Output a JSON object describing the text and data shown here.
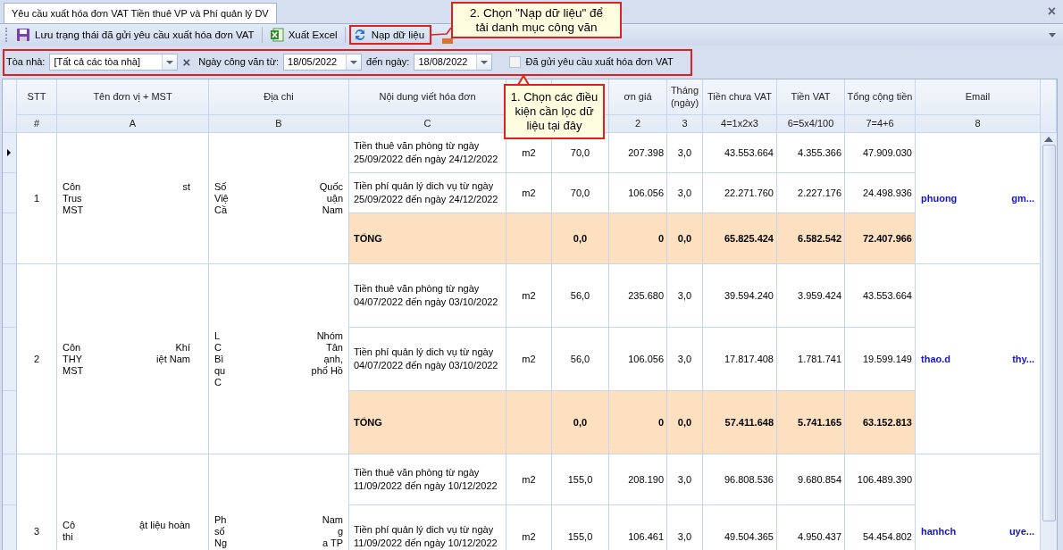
{
  "tab": {
    "title": "Yêu cầu xuất hóa đơn VAT Tiền thuê VP và Phí quản lý DV",
    "selected": true,
    "close": "×"
  },
  "toolbar": [
    {
      "kind": "save",
      "label": "Lưu trạng thái đã gửi yêu cầu xuất hóa đơn VAT"
    },
    {
      "kind": "excel",
      "label": "Xuất Excel"
    },
    {
      "kind": "refresh",
      "label": "Nạp dữ liệu"
    }
  ],
  "filters": {
    "building_label": "Tòa nhà:",
    "building": "[Tất cả các tòa nhà]",
    "clear": "×",
    "from_label": "Ngày công văn từ:",
    "from": "18/05/2022",
    "to_label": "đến ngày:",
    "to": "18/08/2022",
    "sent_label": "Đã gửi yêu cầu xuất hóa đơn VAT",
    "sent_checked": false
  },
  "callouts": [
    {
      "text": "2. Chọn \"Nạp dữ liệu\" để tải danh mục công văn"
    },
    {
      "text": "1. Chọn các điều kiện cần lọc dữ liệu tại đây"
    }
  ],
  "columns": [
    {
      "title": "STT",
      "formula": "#"
    },
    {
      "title": "Tên đơn vị + MST",
      "formula": "A"
    },
    {
      "title": "Địa chi",
      "formula": "B"
    },
    {
      "title": "Nội dung viết hóa đơn",
      "formula": "C"
    },
    {
      "title": "ơn giá",
      "formula": "2"
    },
    {
      "title": "Tháng (ngày)",
      "formula": "3"
    },
    {
      "title": "Tiền chưa VAT",
      "formula": "4=1x2x3"
    },
    {
      "title": "Tiền VAT",
      "formula": "6=5x4/100"
    },
    {
      "title": "Tổng cộng tiền",
      "formula": "7=4+6"
    },
    {
      "title": "Email",
      "formula": "8"
    }
  ],
  "groups": [
    {
      "stt": "1",
      "name": [
        {
          "l": "Côn",
          "r": "st"
        },
        {
          "l": "Trus"
        },
        {
          "l": "MST"
        }
      ],
      "address": [
        {
          "l": "Số",
          "r": "Quốc"
        },
        {
          "l": "Việ",
          "r": "uận"
        },
        {
          "l": "Cầ",
          "r": "Nam"
        }
      ],
      "email": {
        "l": "phuong",
        "r": "gm..."
      },
      "lines": [
        {
          "kind": "item",
          "selected": true,
          "content": "Tiền thuê văn phòng từ ngày 25/09/2022 đến ngày 24/12/2022",
          "unit": "m2",
          "qty": "70,0",
          "price": "207.398",
          "months": "3,0",
          "pre": "43.553.664",
          "vat": "4.355.366",
          "total": "47.909.030"
        },
        {
          "kind": "item",
          "selected": false,
          "content": "Tiền phí quản lý dich vụ từ ngày 25/09/2022 đến ngày 24/12/2022",
          "unit": "m2",
          "qty": "70,0",
          "price": "106.056",
          "months": "3,0",
          "pre": "22.271.760",
          "vat": "2.227.176",
          "total": "24.498.936"
        },
        {
          "kind": "total",
          "selected": false,
          "content": "TỔNG",
          "qty": "0,0",
          "price": "0",
          "months": "0,0",
          "pre": "65.825.424",
          "vat": "6.582.542",
          "total": "72.407.966"
        }
      ]
    },
    {
      "stt": "2",
      "name": [
        {
          "l": "Côn",
          "r": "Khí"
        },
        {
          "l": "THY",
          "r": "iệt Nam"
        },
        {
          "l": "MST"
        }
      ],
      "address": [
        {
          "l": "L",
          "r": "Nhóm"
        },
        {
          "l": "C",
          "r": "Tân"
        },
        {
          "l": "Bì",
          "r": "ạnh,"
        },
        {
          "l": "qu",
          "r": "phố Hồ"
        },
        {
          "l": "C"
        }
      ],
      "email": {
        "l": "thao.d",
        "r": "thy..."
      },
      "lines": [
        {
          "kind": "item",
          "selected": false,
          "content": "Tiền thuê văn phòng từ ngày 04/07/2022 đến ngày 03/10/2022",
          "unit": "m2",
          "qty": "56,0",
          "price": "235.680",
          "months": "3,0",
          "pre": "39.594.240",
          "vat": "3.959.424",
          "total": "43.553.664"
        },
        {
          "kind": "item",
          "selected": false,
          "content": "Tiền phí quản lý dich vụ từ ngày 04/07/2022 đến ngày 03/10/2022",
          "unit": "m2",
          "qty": "56,0",
          "price": "106.056",
          "months": "3,0",
          "pre": "17.817.408",
          "vat": "1.781.741",
          "total": "19.599.149"
        },
        {
          "kind": "total",
          "selected": false,
          "content": "TỔNG",
          "qty": "0,0",
          "price": "0",
          "months": "0,0",
          "pre": "57.411.648",
          "vat": "5.741.165",
          "total": "63.152.813"
        }
      ]
    },
    {
      "stt": "3",
      "name": [
        {
          "l": "Cô",
          "r": "ật liệu hoàn"
        },
        {
          "l": "thi"
        }
      ],
      "address": [
        {
          "l": "Ph",
          "r": "Nam"
        },
        {
          "l": "số",
          "r": "g"
        },
        {
          "l": "Ng",
          "r": "a TP"
        }
      ],
      "email": {
        "l": "hanhch",
        "r": "uye..."
      },
      "lines": [
        {
          "kind": "item",
          "selected": false,
          "content": "Tiền thuê văn phòng từ ngày 11/09/2022 đến ngày 10/12/2022",
          "unit": "m2",
          "qty": "155,0",
          "price": "208.190",
          "months": "3,0",
          "pre": "96.808.536",
          "vat": "9.680.854",
          "total": "106.489.390"
        },
        {
          "kind": "item",
          "selected": false,
          "content": "Tiền phí quản lý dich vụ từ ngày 11/09/2022 đến ngày 10/12/2022",
          "unit": "m2",
          "qty": "155,0",
          "price": "106.461",
          "months": "3,0",
          "pre": "49.504.365",
          "vat": "4.950.437",
          "total": "54.454.802"
        }
      ]
    }
  ]
}
